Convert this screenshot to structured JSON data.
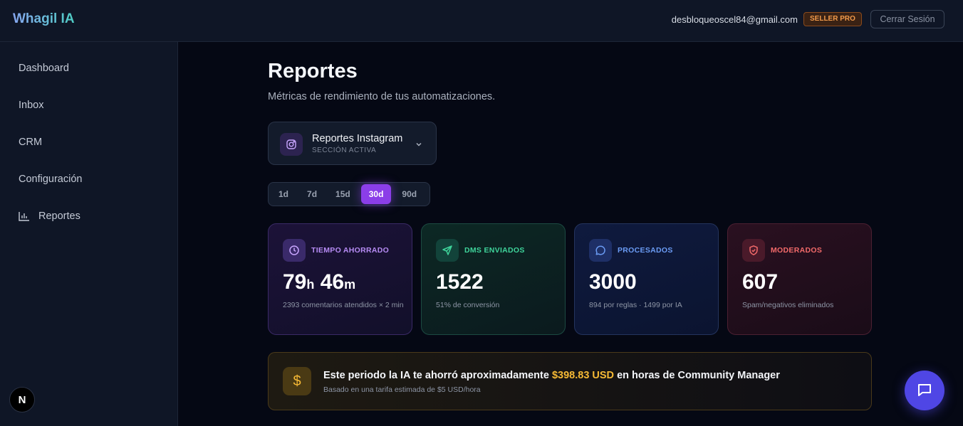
{
  "header": {
    "brand": "Whagil IA",
    "user_email": "desbloqueoscel84@gmail.com",
    "plan_badge": "SELLER PRO",
    "logout_label": "Cerrar Sesión"
  },
  "sidebar": {
    "items": [
      {
        "label": "Dashboard"
      },
      {
        "label": "Inbox"
      },
      {
        "label": "CRM"
      },
      {
        "label": "Configuración"
      },
      {
        "label": "Reportes",
        "icon": "bar-chart-icon"
      }
    ],
    "footer_badge": "N"
  },
  "page": {
    "title": "Reportes",
    "subtitle": "Métricas de rendimiento de tus automatizaciones."
  },
  "section_select": {
    "title": "Reportes Instagram",
    "subtitle": "SECCIÓN ACTIVA",
    "icon": "instagram-icon"
  },
  "periods": {
    "options": [
      "1d",
      "7d",
      "15d",
      "30d",
      "90d"
    ],
    "selected": "30d"
  },
  "cards": [
    {
      "label": "TIEMPO AHORRADO",
      "value_hours": "79",
      "unit_h": "h",
      "value_minutes": "46",
      "unit_m": "m",
      "note": "2393 comentarios atendidos × 2 min",
      "icon": "clock-icon",
      "color": "#b78cf5"
    },
    {
      "label": "DMS ENVIADOS",
      "value": "1522",
      "note": "51% de conversión",
      "icon": "send-icon",
      "color": "#3fd49b"
    },
    {
      "label": "PROCESADOS",
      "value": "3000",
      "note": "894 por reglas · 1499 por IA",
      "icon": "chat-bubble-icon",
      "color": "#6b9cf5"
    },
    {
      "label": "MODERADOS",
      "value": "607",
      "note": "Spam/negativos eliminados",
      "icon": "shield-icon",
      "color": "#f26a6a"
    }
  ],
  "savings": {
    "prefix": "Este periodo la IA te ahorró aproximadamente",
    "amount": "$398.83 USD",
    "suffix": "en horas de Community Manager",
    "note": "Basado en una tarifa estimada de $5 USD/hora",
    "icon": "dollar-icon",
    "accent": "#f5b935"
  },
  "chat_fab": {
    "icon": "chat-icon"
  }
}
